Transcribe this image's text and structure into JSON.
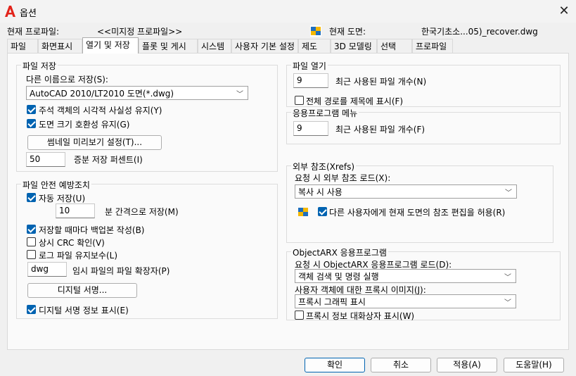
{
  "window": {
    "title": "옵션"
  },
  "header": {
    "profile_label": "현재 프로파일:",
    "profile_value": "<<미지정 프로파일>>",
    "drawing_label": "현재 도면:",
    "drawing_value": "한국기초소...05)_recover.dwg"
  },
  "tabs": [
    "파일",
    "화면표시",
    "열기 및 저장",
    "플롯 및 게시",
    "시스템",
    "사용자 기본 설정",
    "제도",
    "3D 모델링",
    "선택",
    "프로파일"
  ],
  "active_tab": "열기 및 저장",
  "file_save": {
    "title": "파일 저장",
    "save_as_label": "다른 이름으로 저장(S):",
    "save_as_value": "AutoCAD 2010/LT2010 도면(*.dwg)",
    "annot_visual": {
      "label": "주석 객체의 시각적 사실성 유지(Y)",
      "checked": true
    },
    "drawing_size": {
      "label": "도면 크기 호환성 유지(G)",
      "checked": true
    },
    "thumbnail_button": "썸네일 미리보기 설정(T)...",
    "incremental_value": "50",
    "incremental_label": "증분 저장 퍼센트(I)"
  },
  "safety": {
    "title": "파일 안전 예방조치",
    "autosave": {
      "label": "자동 저장(U)",
      "checked": true
    },
    "minutes_value": "10",
    "minutes_label": "분 간격으로 저장(M)",
    "backup": {
      "label": "저장할 때마다 백업본 작성(B)",
      "checked": true
    },
    "crc": {
      "label": "상시 CRC 확인(V)",
      "checked": false
    },
    "log": {
      "label": "로그 파일 유지보수(L)",
      "checked": false
    },
    "temp_ext_value": "dwg",
    "temp_ext_label": "임시 파일의 파일 확장자(P)",
    "signature_button": "디지털 서명...",
    "signature_info": {
      "label": "디지털 서명 정보 표시(E)",
      "checked": true
    }
  },
  "file_open": {
    "title": "파일 열기",
    "recent_value": "9",
    "recent_label": "최근 사용된 파일 개수(N)",
    "full_path": {
      "label": "전체 경로를 제목에 표시(F)",
      "checked": false
    }
  },
  "app_menu": {
    "title": "응용프로그램 메뉴",
    "recent_value": "9",
    "recent_label": "최근 사용된 파일 개수(F)"
  },
  "xrefs": {
    "title": "외부 참조(Xrefs)",
    "demand_label": "요청 시 외부 참조 로드(X):",
    "demand_value": "복사 시 사용",
    "allow_edit": {
      "label": "다른 사용자에게 현재 도면의 참조 편집을 허용(R)",
      "checked": true
    }
  },
  "objectarx": {
    "title": "ObjectARX 응용프로그램",
    "demand_label": "요청 시 ObjectARX 응용프로그램 로드(D):",
    "demand_value": "객체 검색 및 명령 실행",
    "proxy_label": "사용자 객체에 대한 프록시 이미지(J):",
    "proxy_value": "프록시 그래픽 표시",
    "proxy_dialog": {
      "label": "프록시 정보 대화상자 표시(W)",
      "checked": false
    }
  },
  "footer": {
    "ok": "확인",
    "cancel": "취소",
    "apply": "적용(A)",
    "help": "도움말(H)"
  },
  "colors": {
    "accent": "#0063b1",
    "brand_red": "#e2231a"
  }
}
